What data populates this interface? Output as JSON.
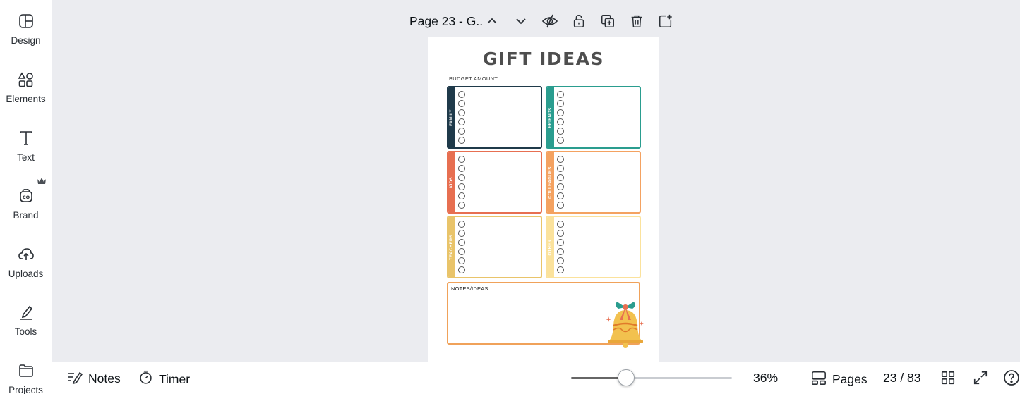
{
  "sidebar": {
    "items": [
      {
        "label": "Design",
        "icon": "layout-icon"
      },
      {
        "label": "Elements",
        "icon": "shapes-icon"
      },
      {
        "label": "Text",
        "icon": "text-icon"
      },
      {
        "label": "Brand",
        "icon": "brand-icon"
      },
      {
        "label": "Uploads",
        "icon": "cloud-upload-icon"
      },
      {
        "label": "Tools",
        "icon": "draw-icon"
      },
      {
        "label": "Projects",
        "icon": "folder-icon"
      }
    ]
  },
  "page_toolbar": {
    "title": "Page 23 - G..",
    "icons": [
      "chevron-up-icon",
      "chevron-down-icon",
      "hide-icon",
      "lock-icon",
      "duplicate-icon",
      "trash-icon",
      "add-page-icon"
    ]
  },
  "document": {
    "title": "GIFT IDEAS",
    "budget_label": "BUDGET AMOUNT:",
    "boxes": [
      {
        "label": "FAMILY",
        "color": "#1f3a4a"
      },
      {
        "label": "FRIENDS",
        "color": "#2a9d8f"
      },
      {
        "label": "KIDS",
        "color": "#e76f51"
      },
      {
        "label": "COLLEAGUES",
        "color": "#f4a261"
      },
      {
        "label": "TEACHERS",
        "color": "#e9c46a"
      },
      {
        "label": "OTHER",
        "color": "#fbe29c"
      }
    ],
    "notes_label": "NOTES/IDEAS",
    "notes_color": "#f0a25a"
  },
  "bottombar": {
    "notes_label": "Notes",
    "timer_label": "Timer",
    "zoom_fraction": 0.34,
    "zoom_value": "36%",
    "pages_label": "Pages",
    "page_count": "23 / 83"
  }
}
